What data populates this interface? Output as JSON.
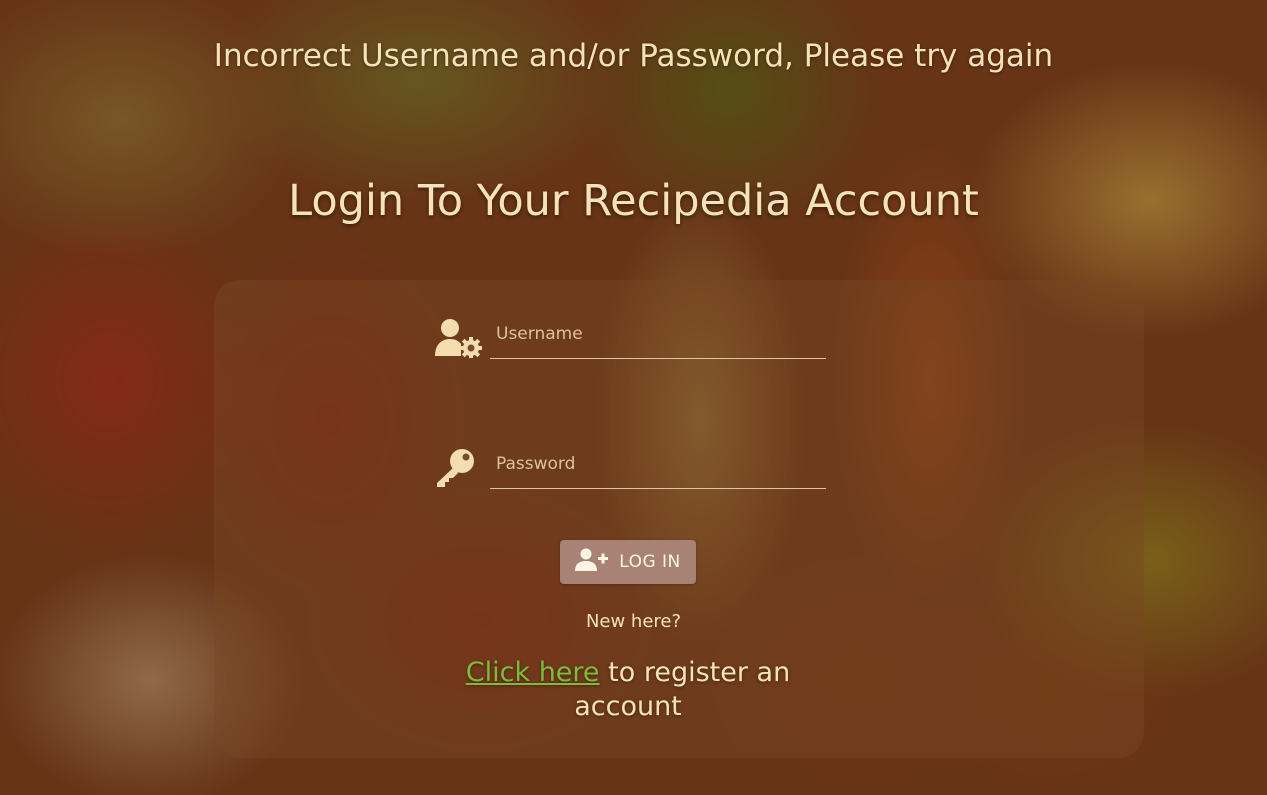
{
  "error_message": "Incorrect Username and/or Password, Please try again",
  "title": "Login To Your Recipedia Account",
  "form": {
    "username_placeholder": "Username",
    "password_placeholder": "Password",
    "username_icon": "user-gear-icon",
    "password_icon": "key-icon"
  },
  "login_button": {
    "label": "LOG IN",
    "icon": "user-plus-icon"
  },
  "new_here": "New here?",
  "register": {
    "link_text": "Click here",
    "rest_text": "to register an account"
  },
  "colors": {
    "text": "#f6e2b8",
    "link": "#7dbb3a",
    "button": "#a98276"
  }
}
